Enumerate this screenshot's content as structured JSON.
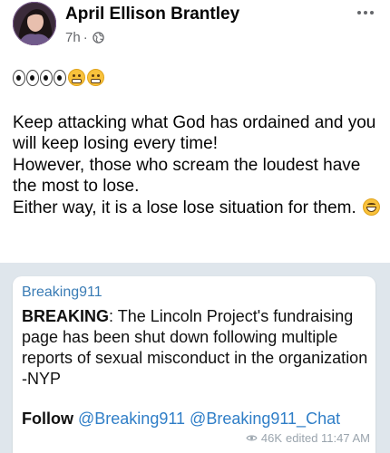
{
  "post": {
    "author": "April Ellison Brantley",
    "time": "7h",
    "separator": "·",
    "privacy_icon": "globe-icon",
    "more_icon": "more-horizontal-icon",
    "reaction_emojis": [
      "eyes-emoji",
      "eyes-emoji",
      "face-with-hand-over-mouth-emoji",
      "face-with-hand-over-mouth-emoji"
    ],
    "text_lines": [
      "Keep attacking what God has ordained and you will keep losing every time!",
      "However, those who scream the loudest have the most to lose.",
      "Either way, it is a lose lose situation for them."
    ],
    "trailing_emoji": "grinning-squinting-face-emoji"
  },
  "shared": {
    "channel": "Breaking911",
    "headline_bold": "BREAKING",
    "headline_rest": ": The Lincoln Project's fundraising page has been shut down following multiple reports of sexual misconduct in the organization  -NYP",
    "follow_label": "Follow",
    "follow_handle_1": "@Breaking911",
    "follow_handle_2": "@Breaking911_Chat",
    "views": "46K",
    "edited": "edited 11:47 AM"
  },
  "colors": {
    "text": "#050505",
    "meta": "#65676b",
    "channel": "#3a7cb5",
    "link": "#2f7ec7",
    "image_bg": "#dfe6ec"
  }
}
